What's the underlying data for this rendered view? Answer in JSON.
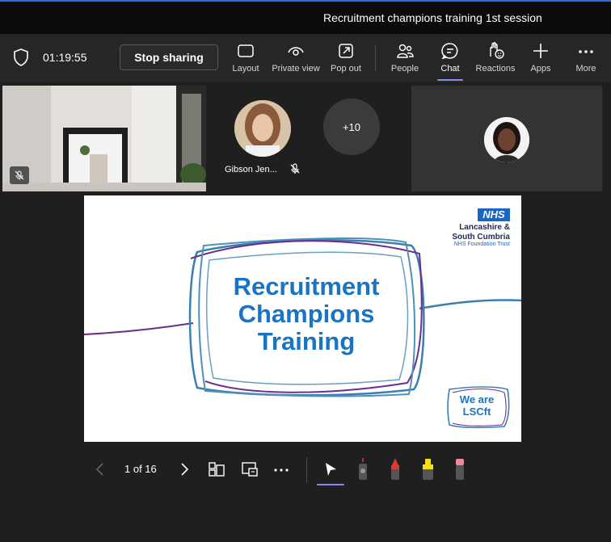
{
  "window": {
    "title": "Recruitment champions training 1st session"
  },
  "toolbar": {
    "timer": "01:19:55",
    "stop_sharing_label": "Stop sharing",
    "buttons": [
      {
        "label": "Layout",
        "icon": "layout-icon"
      },
      {
        "label": "Private view",
        "icon": "eye-icon"
      },
      {
        "label": "Pop out",
        "icon": "pop-out-icon"
      },
      {
        "label": "People",
        "icon": "people-icon"
      },
      {
        "label": "Chat",
        "icon": "chat-icon",
        "active": true
      },
      {
        "label": "Reactions",
        "icon": "reactions-icon"
      },
      {
        "label": "Apps",
        "icon": "plus-icon"
      },
      {
        "label": "More",
        "icon": "more-icon"
      }
    ]
  },
  "participants": {
    "named": {
      "name": "Gibson Jen..."
    },
    "overflow_count": "+10"
  },
  "slide": {
    "title_lines": [
      "Recruitment",
      "Champions",
      "Training"
    ],
    "logo": {
      "nhs": "NHS",
      "org_line1": "Lancashire &",
      "org_line2": "South Cumbria",
      "org_line3": "NHS Foundation Trust"
    },
    "badge_line1": "We are",
    "badge_line2": "LSCft",
    "colors": {
      "title": "#1a74c4",
      "line_blue": "#3a7fb0",
      "line_purple": "#6b2d90"
    }
  },
  "presenter_controls": {
    "page_indicator": "1 of 16",
    "tools": [
      "pointer-icon",
      "laser-pen-icon",
      "red-pen-icon",
      "highlighter-icon",
      "eraser-icon"
    ]
  },
  "theme": {
    "accent": "#8b8cf0",
    "toolbar_bg": "#262626",
    "stage_bg": "#1f1f1f"
  }
}
